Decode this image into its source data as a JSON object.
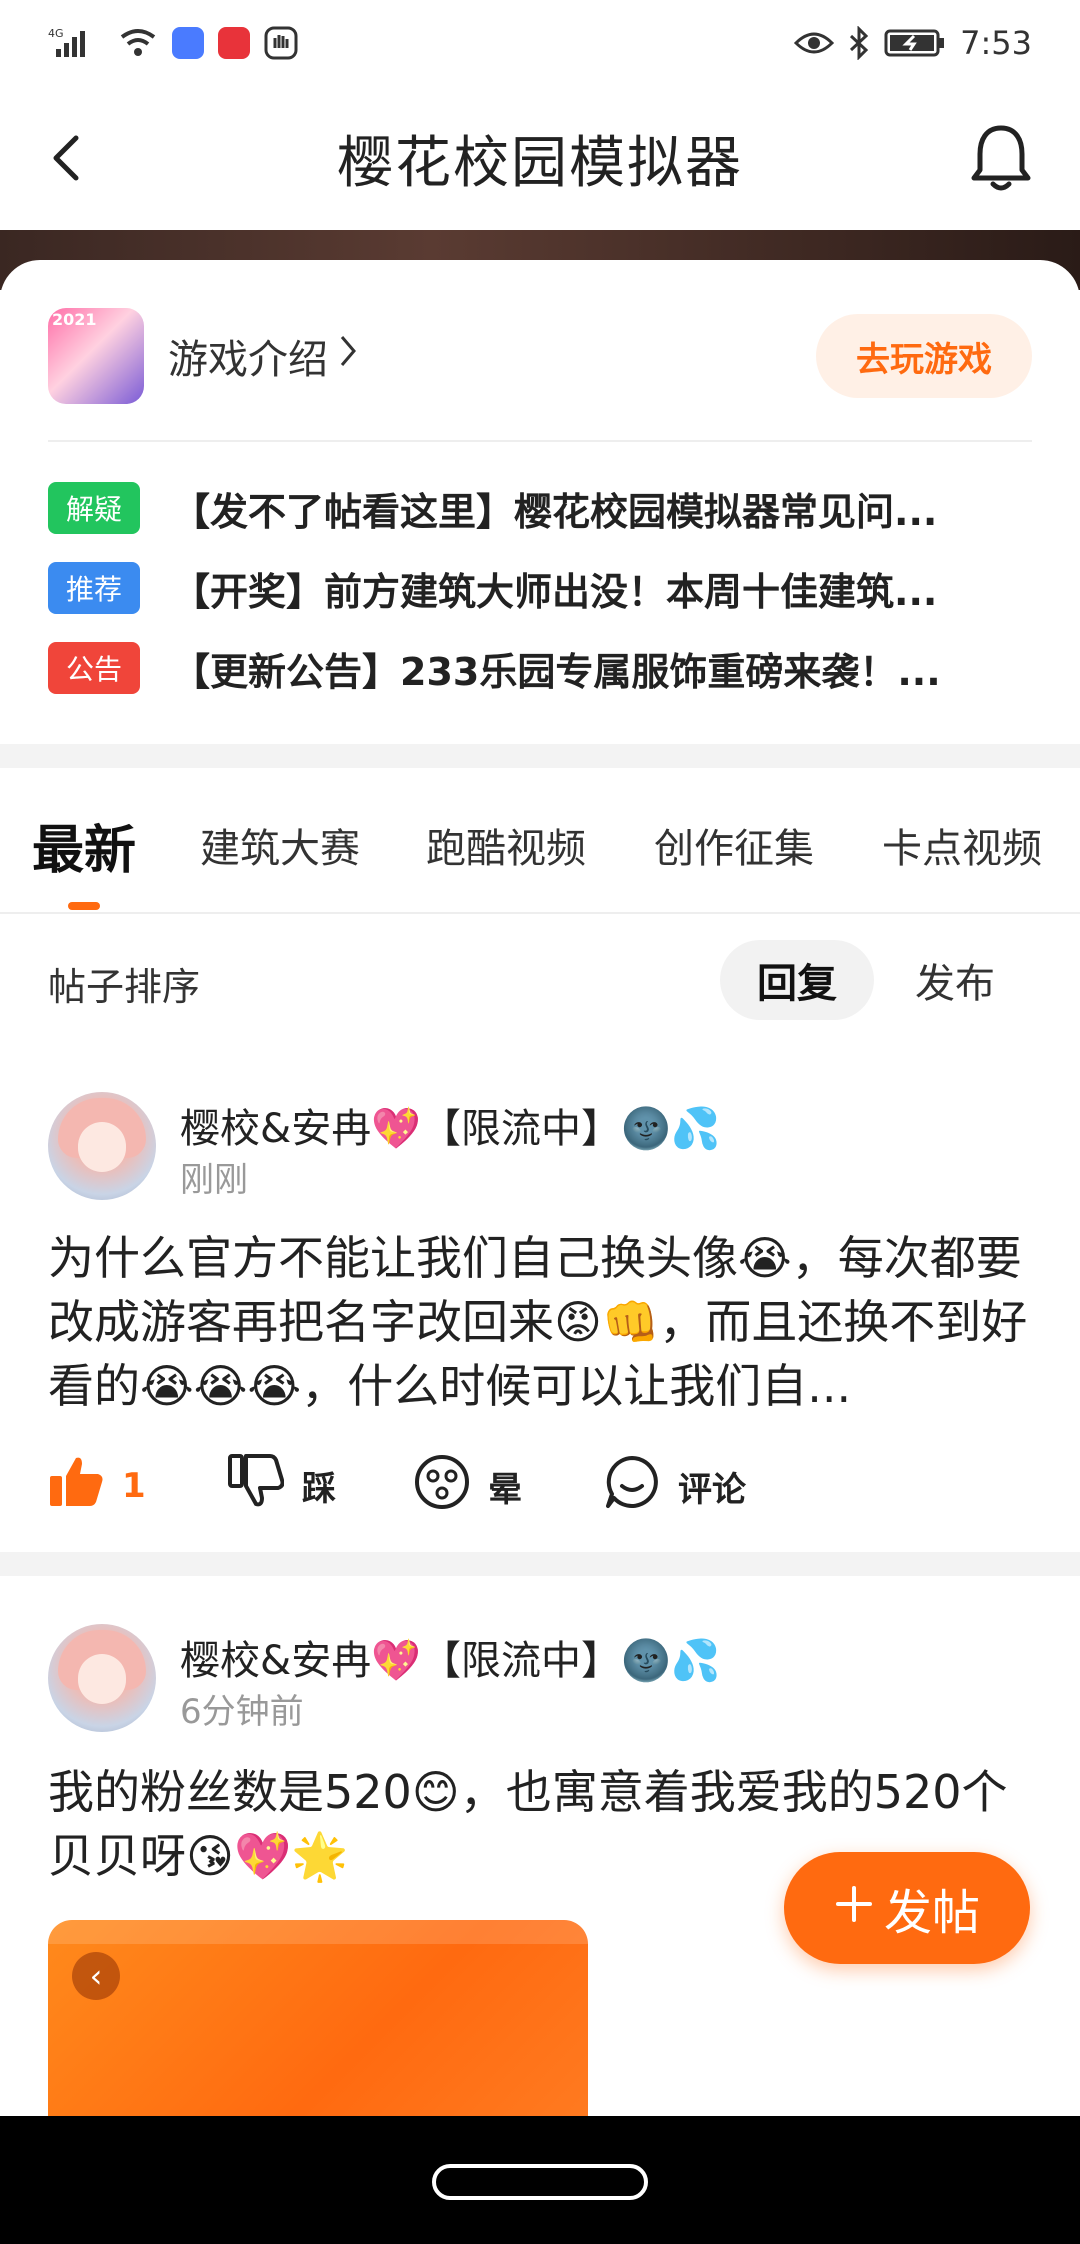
{
  "status_bar": {
    "network": "4G",
    "time": "7:53"
  },
  "header": {
    "title": "樱花校园模拟器"
  },
  "game_card": {
    "year_badge": "2021",
    "intro_label": "游戏介绍",
    "play_button": "去玩游戏"
  },
  "notices": [
    {
      "tag": "解疑",
      "color": "#22c55e",
      "text": "【发不了帖看这里】樱花校园模拟器常见问..."
    },
    {
      "tag": "推荐",
      "color": "#3b8bf0",
      "text": "【开奖】前方建筑大师出没！本周十佳建筑..."
    },
    {
      "tag": "公告",
      "color": "#f0453a",
      "text": "【更新公告】233乐园专属服饰重磅来袭！..."
    }
  ],
  "tabs": [
    "最新",
    "建筑大赛",
    "跑酷视频",
    "创作征集",
    "卡点视频"
  ],
  "sort": {
    "label": "帖子排序",
    "reply": "回复",
    "publish": "发布"
  },
  "posts": [
    {
      "author": "樱校&安冉💖【限流中】🌚💦",
      "time": "刚刚",
      "content": "为什么官方不能让我们自己换头像😭，每次都要改成游客再把名字改回来😡👊，而且还换不到好看的😭😭😭，什么时候可以让我们自...",
      "likes": "1",
      "dislike_label": "踩",
      "dizzy_label": "晕",
      "comment_label": "评论"
    },
    {
      "author": "樱校&安冉💖【限流中】🌚💦",
      "time": "6分钟前",
      "content": "我的粉丝数是520😊，也寓意着我爱我的520个贝贝呀😘💖🌟"
    }
  ],
  "fab": {
    "label": "发帖"
  },
  "colors": {
    "accent": "#ff6a10",
    "accent_light": "#fff0e6"
  }
}
